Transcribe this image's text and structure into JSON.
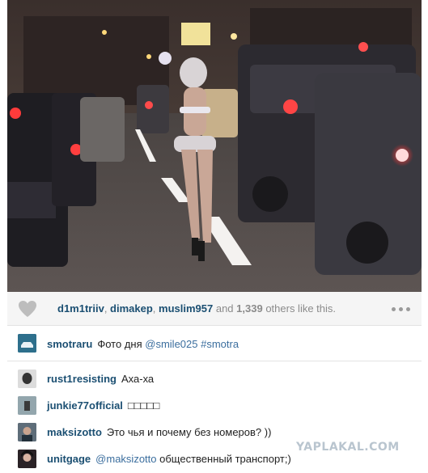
{
  "post": {
    "photo": {
      "description_icon": "photo"
    },
    "likes": {
      "users": [
        "d1m1triiv",
        "dimakep",
        "muslim957"
      ],
      "sep1": ", ",
      "sep2": ", ",
      "and_text": " and ",
      "count": "1,339",
      "suffix": " others like this."
    },
    "caption": {
      "username": "smotraru",
      "text": "Фото дня ",
      "mention": "@smile025",
      "tag": " #smotra"
    },
    "comments": [
      {
        "username": "rust1resisting",
        "text": "Аха-ха",
        "mention": ""
      },
      {
        "username": "junkie77official",
        "text": "□□□□□",
        "mention": ""
      },
      {
        "username": "maksizotto",
        "text": "Это чья и почему без номеров? ))",
        "mention": ""
      },
      {
        "username": "unitgage",
        "text": " общественный транспорт;)",
        "mention": "@maksizotto"
      }
    ]
  },
  "watermark": "YAPLAKAL.COM",
  "colors": {
    "username": "#1b4f72",
    "mention": "#3b6e9e",
    "bar_bg": "#f5f5f5"
  }
}
